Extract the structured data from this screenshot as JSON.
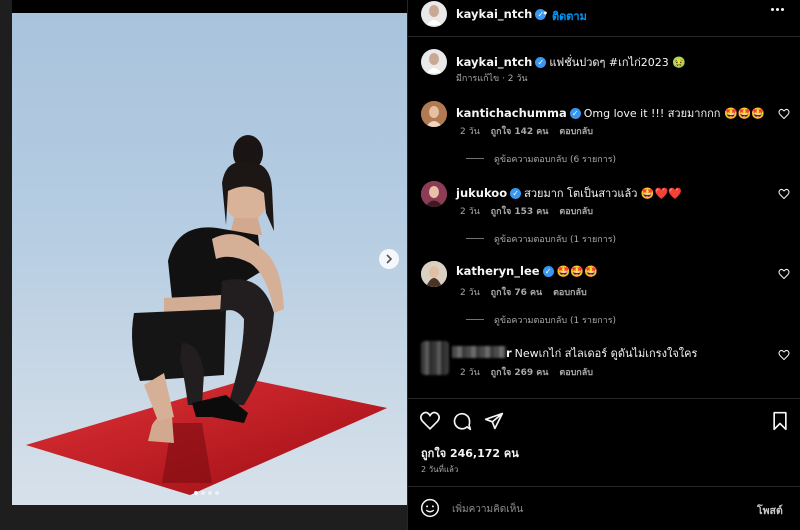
{
  "post": {
    "username": "kaykai_ntch",
    "follow_label": "ติดตาม",
    "caption": "แฟชั่นปวดๆ #เกไก่2023 🤢",
    "caption_meta": "มีการแก้ไข · 2 วัน",
    "likes": "ถูกใจ 246,172 คน",
    "time_ago": "2 วันที่แล้ว",
    "comment_placeholder": "เพิ่มความคิดเห็น",
    "post_label": "โพสต์"
  },
  "comments": [
    {
      "username": "kantichachumma",
      "text": "Omg love it !!! สวยมากกก 🤩🤩🤩",
      "time": "2 วัน",
      "likes": "ถูกใจ 142 คน",
      "reply": "ตอบกลับ",
      "view_replies": "ดูข้อความตอบกลับ (6 รายการ)"
    },
    {
      "username": "jukukoo",
      "text": "สวยมาก โตเป็นสาวแล้ว 🤩❤️❤️",
      "time": "2 วัน",
      "likes": "ถูกใจ 153 คน",
      "reply": "ตอบกลับ",
      "view_replies": "ดูข้อความตอบกลับ (1 รายการ)"
    },
    {
      "username": "katheryn_lee",
      "text": "🤩🤩🤩",
      "time": "2 วัน",
      "likes": "ถูกใจ 76 คน",
      "reply": "ตอบกลับ",
      "view_replies": "ดูข้อความตอบกลับ (1 รายการ)"
    },
    {
      "username": "r",
      "text": "Newเกไก่ สไลเดอร์ ดูดันไม่เกรงใจใคร",
      "time": "2 วัน",
      "likes": "ถูกใจ 269 คน",
      "reply": "ตอบกลับ"
    }
  ],
  "colors": {
    "background": "#000000",
    "verified": "#3897f0",
    "follow": "#0095f6",
    "muted_text": "#a8a8a8"
  },
  "carousel": {
    "slides": 4,
    "current": 1
  }
}
